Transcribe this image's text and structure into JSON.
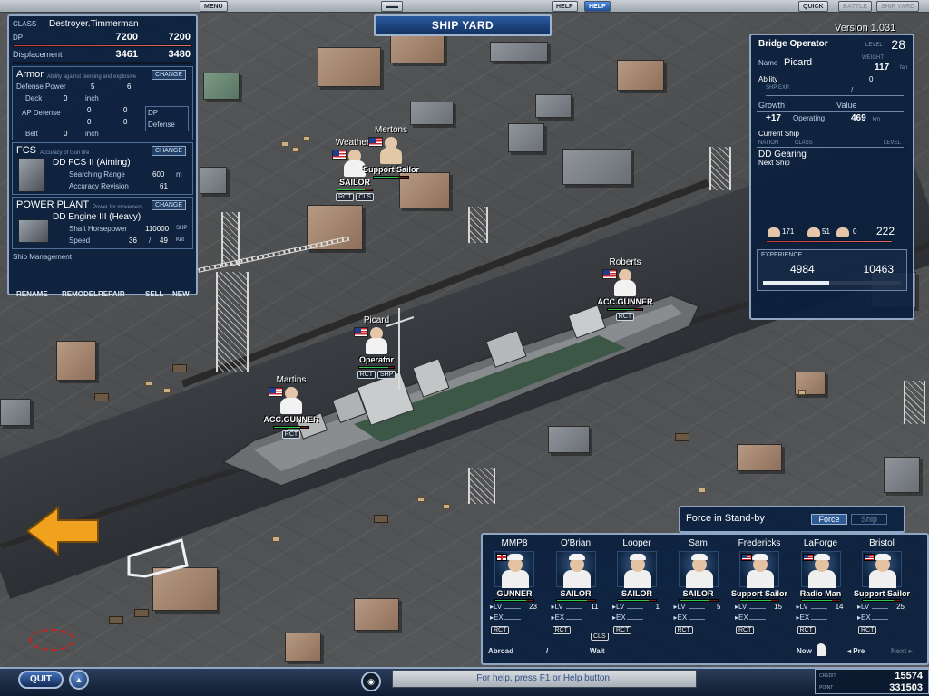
{
  "topbar": {
    "menu": "MENU",
    "help_label": "HELP",
    "help_button": "HELP",
    "quick": "QUICK",
    "battle": "BATTLE",
    "shipyard": "SHIP YARD"
  },
  "banner": "SHIP YARD",
  "version": "Version 1.031",
  "ship": {
    "class_label": "CLASS",
    "class_value": "Destroyer.Timmerman",
    "dp_label": "DP",
    "dp_current": "7200",
    "dp_max": "7200",
    "disp_label": "Displacement",
    "disp_current": "3461",
    "disp_max": "3480",
    "armor": {
      "title": "Armor",
      "subtitle": "Ability against piercing and explosive",
      "change": "CHANGE",
      "defense_power_label": "Defense Power",
      "defense_power_a": "5",
      "defense_power_b": "6",
      "deck_label": "Deck",
      "deck_value": "0",
      "deck_unit": "inch",
      "ap_label": "AP Defense",
      "ap_a1": "0",
      "ap_a2": "0",
      "ap_b1": "0",
      "ap_b2": "0",
      "dp_defense_label": "DP Defense",
      "belt_label": "Belt",
      "belt_value": "0",
      "belt_unit": "inch"
    },
    "fcs": {
      "title": "FCS",
      "subtitle": "Accuracy of Gun fire",
      "change": "CHANGE",
      "name": "DD FCS II (Aiming)",
      "range_label": "Searching Range",
      "range_value": "600",
      "range_unit": "m",
      "acc_label": "Accuracy Revision",
      "acc_value": "61"
    },
    "power": {
      "title": "POWER PLANT",
      "subtitle": "Power for movement",
      "change": "CHANGE",
      "name": "DD Engine III (Heavy)",
      "shp_label": "Shaft Horsepower",
      "shp_value": "110000",
      "shp_unit": "SHP",
      "speed_label": "Speed",
      "speed_current": "36",
      "speed_max": "49",
      "speed_unit": "Knt"
    },
    "management_label": "Ship Management",
    "actions": {
      "rename": "RENAME",
      "remodel": "REMODEL",
      "repair": "REPAIR",
      "sell": "SELL",
      "new": "NEW"
    }
  },
  "operator": {
    "title": "Bridge Operator",
    "level_label": "LEVEL",
    "level": "28",
    "name_label": "Name",
    "name": "Picard",
    "weight_label": "WEIGHT",
    "weight": "117",
    "weight_unit": "fan",
    "ability_label": "Ability",
    "shp_exp_label": "SHP EXP.",
    "shp_exp_value": "0",
    "growth_label": "Growth",
    "growth_value": "+17",
    "value_label": "Value",
    "operating_label": "Operating",
    "operating_value": "469",
    "operating_unit": "km",
    "current_ship_label": "Current Ship",
    "nation_label": "NATION",
    "class_label": "CLASS",
    "level_col_label": "LEVEL",
    "current_ship": "DD Gearing",
    "next_ship_label": "Next Ship",
    "crew_counts": [
      "171",
      "51",
      "0"
    ],
    "total": "222",
    "experience_label": "EXPERIENCE",
    "exp_current": "4984",
    "exp_max": "10463",
    "exp_fraction": 0.48
  },
  "onship_crew": [
    {
      "name": "Weathers",
      "role": "SAILOR",
      "tags": [
        "RCT",
        "CLS"
      ]
    },
    {
      "name": "Mertons",
      "role": "Support Sailor",
      "tags": []
    },
    {
      "name": "Roberts",
      "role": "ACC.GUNNER",
      "tags": [
        "RCT"
      ]
    },
    {
      "name": "Picard",
      "role": "Operator",
      "tags": [
        "RCT",
        "SHP"
      ]
    },
    {
      "name": "Martins",
      "role": "ACC.GUNNER",
      "tags": [
        "RCT"
      ]
    }
  ],
  "force": {
    "title": "Force in Stand-by",
    "tab_force": "Force",
    "tab_ship": "Ship",
    "lv_label": "LV",
    "ex_label": "EX",
    "crew": [
      {
        "name": "MMP8",
        "role": "GUNNER",
        "lv": "23",
        "flag": "uk",
        "tag": "RCT"
      },
      {
        "name": "O'Brian",
        "role": "SAILOR",
        "lv": "11",
        "flag": "none",
        "tag": "RCT"
      },
      {
        "name": "Looper",
        "role": "SAILOR",
        "lv": "1",
        "flag": "none",
        "tag": "RCT"
      },
      {
        "name": "Sam",
        "role": "SAILOR",
        "lv": "5",
        "flag": "none",
        "tag": "RCT"
      },
      {
        "name": "Fredericks",
        "role": "Support Sailor",
        "lv": "15",
        "flag": "us",
        "tag": "RCT"
      },
      {
        "name": "LaForge",
        "role": "Radio Man",
        "lv": "14",
        "flag": "us",
        "tag": "RCT"
      },
      {
        "name": "Bristol",
        "role": "Support Sailor",
        "lv": "25",
        "flag": "us",
        "tag": "RCT"
      }
    ],
    "extra_tag": "CLS",
    "abroad": "Abroad",
    "slash": "/",
    "wait": "Wait",
    "now": "Now",
    "pre": "Pre",
    "next": "Next"
  },
  "bottom": {
    "quit": "QUIT",
    "help_text": "For help, press F1 or Help button.",
    "credit_label": "CREDIT",
    "credit_value": "15574",
    "point_label": "POINT",
    "point_value": "331503"
  }
}
